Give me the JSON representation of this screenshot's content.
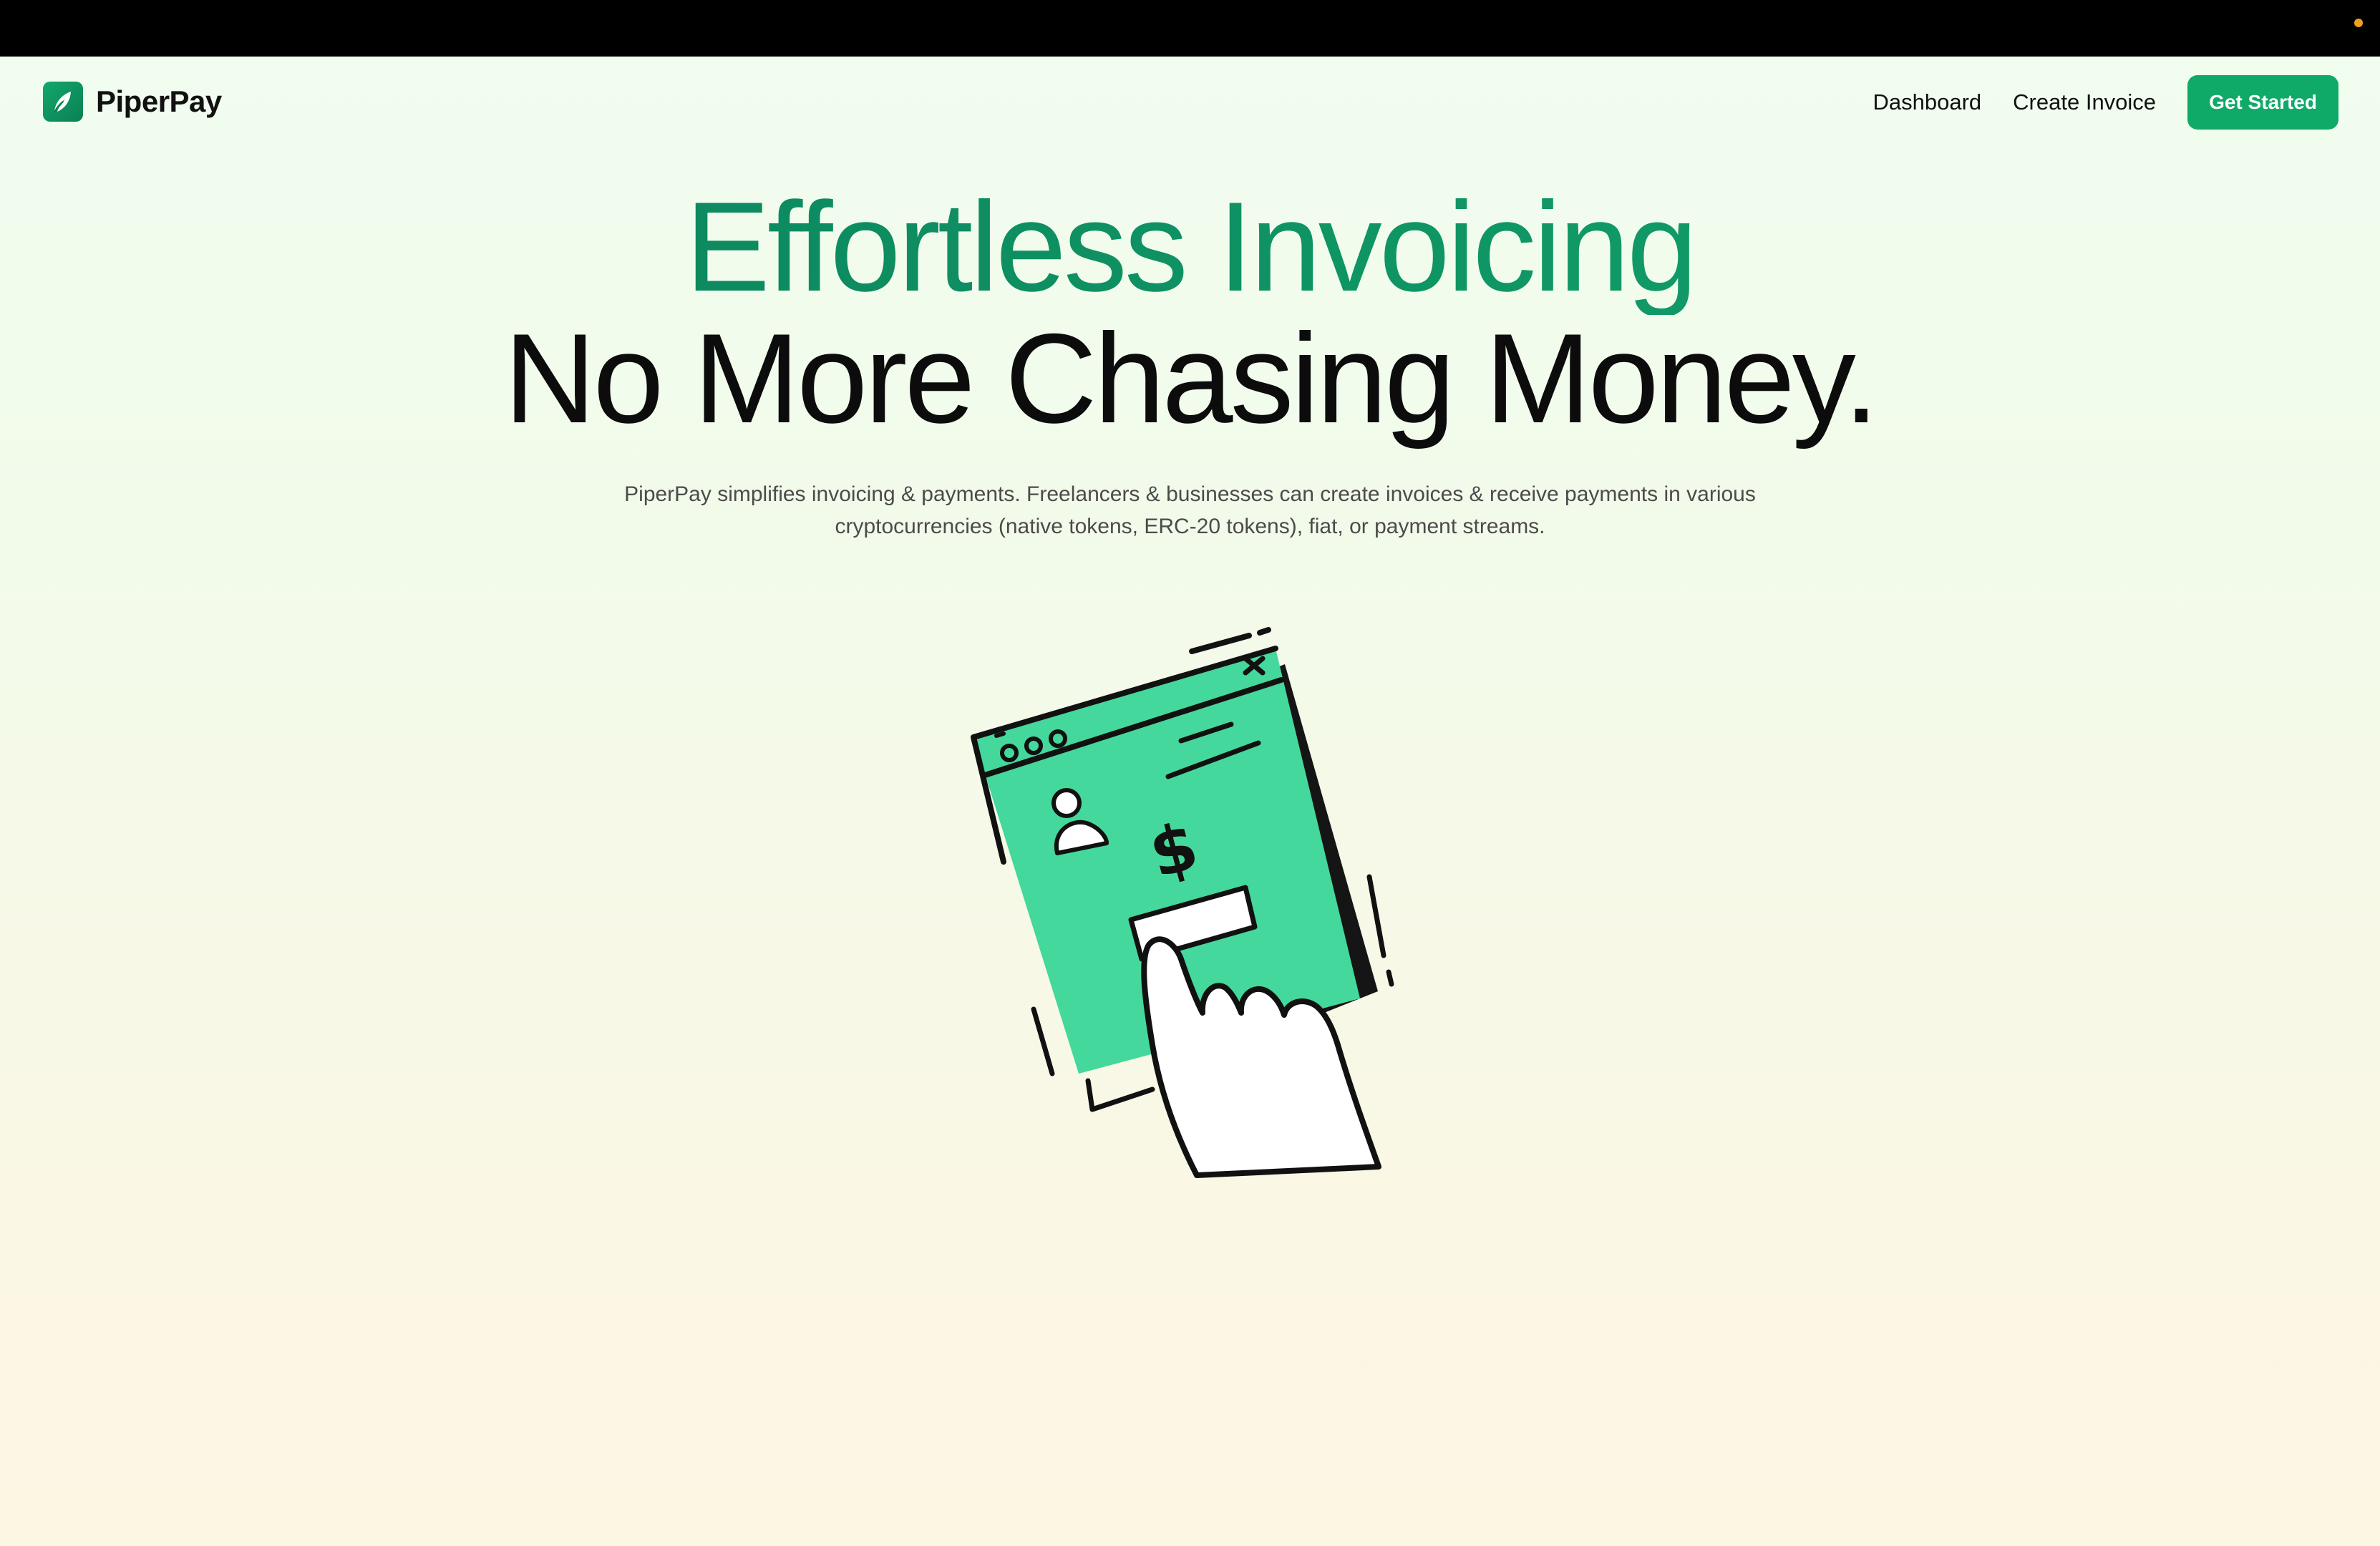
{
  "brand": {
    "name": "PiperPay",
    "logo_icon": "feather-icon",
    "accent": "#0fa968"
  },
  "nav": {
    "links": [
      {
        "label": "Dashboard"
      },
      {
        "label": "Create Invoice"
      }
    ],
    "cta_label": "Get Started"
  },
  "hero": {
    "headline_line1": "Effortless Invoicing",
    "headline_line2": "No More Chasing Money.",
    "subtitle": "PiperPay simplifies invoicing & payments. Freelancers & businesses can create invoices & receive payments in various cryptocurrencies (native tokens, ERC-20 tokens), fiat, or payment streams.",
    "illustration_icon": "invoice-payment-hand-icon",
    "headline_color": "#0f8c66",
    "illustration_color": "#45d89c"
  }
}
